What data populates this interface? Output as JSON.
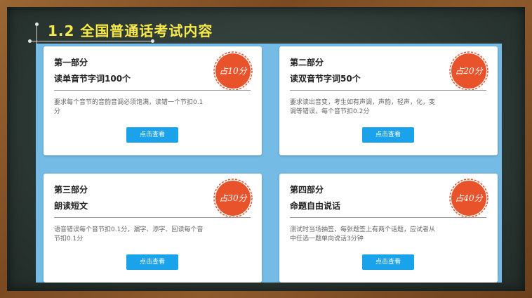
{
  "slide": {
    "title": "1.2  全国普通话考试内容",
    "button_label": "点击查看",
    "cards": [
      {
        "part": "第一部分",
        "topic": "读单音节字词100个",
        "stamp": "占10分",
        "description": "要求每个音节的音韵音调必须饱满，读错一个节扣0.1分"
      },
      {
        "part": "第二部分",
        "topic": "读双音节字词50个",
        "stamp": "占20分",
        "description": "要求读出音变，考生如有声调，声韵，轻声，化，变调等错误，每个音节扣0.2分"
      },
      {
        "part": "第三部分",
        "topic": "朗读短文",
        "stamp": "占30分",
        "description": "语音错误每个音节扣0.1分，漏字、添字、回读每个音节扣0.1分"
      },
      {
        "part": "第四部分",
        "topic": "命题自由说话",
        "stamp": "占40分",
        "description": "测试时当场抽签，每张题签上有两个话题，应试者从中任选一题单向说话3分钟"
      }
    ]
  },
  "colors": {
    "title": "#f6e948",
    "panel": "#74bbe6",
    "button": "#1aa3ea",
    "stamp": "#e8532c"
  }
}
